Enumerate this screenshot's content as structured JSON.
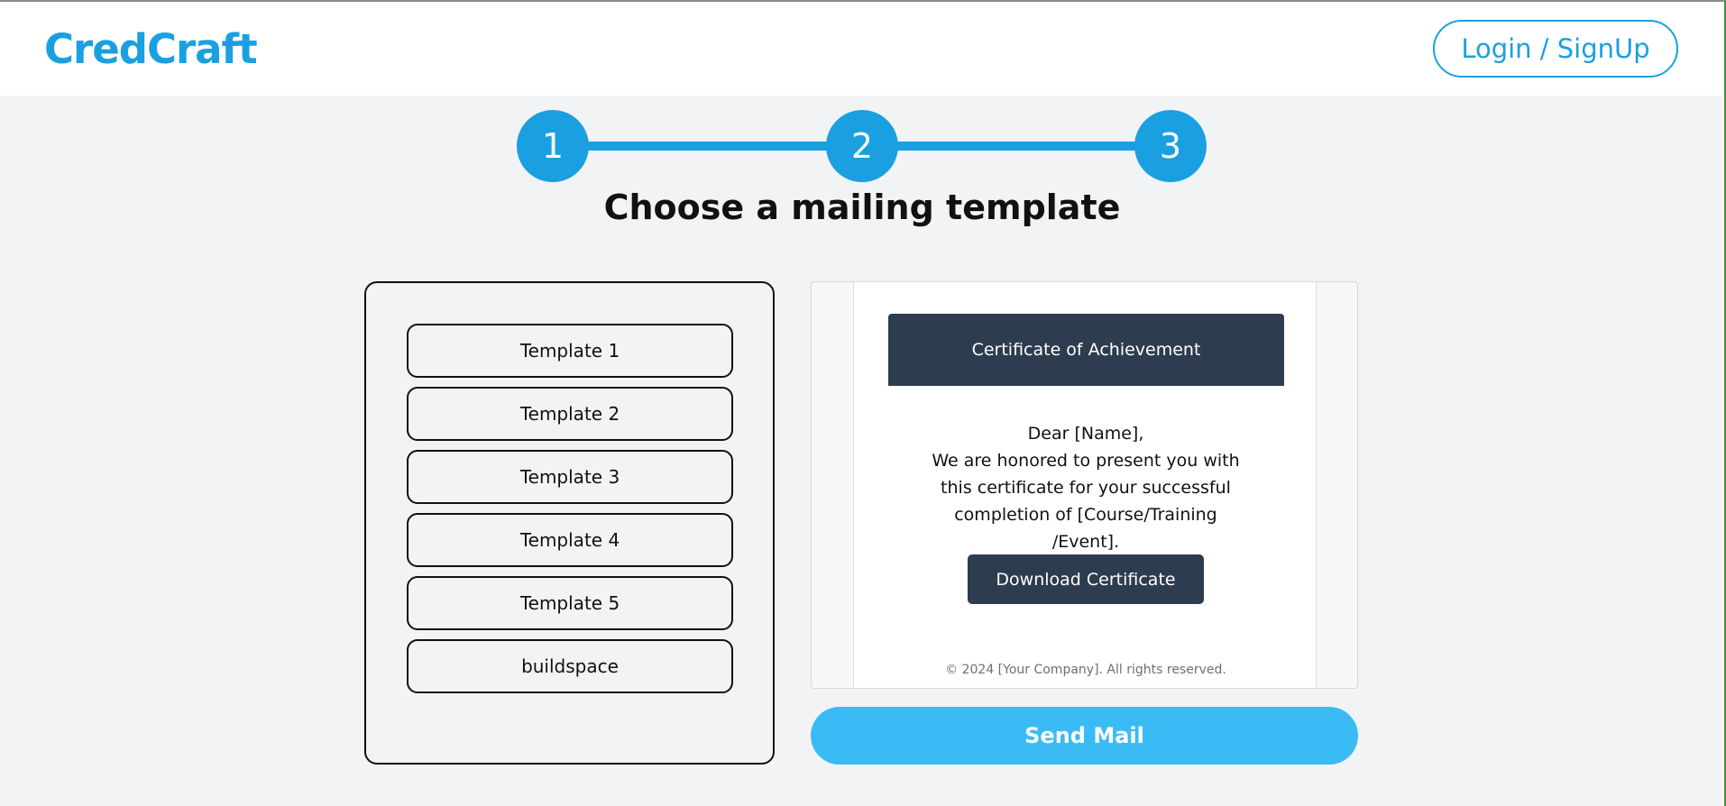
{
  "header": {
    "logo": "CredCraft",
    "login_label": "Login / SignUp"
  },
  "stepper": {
    "steps": [
      "1",
      "2",
      "3"
    ]
  },
  "main": {
    "title": "Choose a mailing template"
  },
  "templates": {
    "items": [
      "Template 1",
      "Template 2",
      "Template 3",
      "Template 4",
      "Template 5",
      "buildspace"
    ]
  },
  "preview": {
    "cert_title": "Certificate of Achievement",
    "greeting": "Dear [Name],",
    "message": "We are honored to present you with this certificate for your successful completion of [Course/Training /Event].",
    "download_label": "Download Certificate",
    "footer": "© 2024 [Your Company]. All rights reserved."
  },
  "actions": {
    "send_label": "Send Mail"
  },
  "colors": {
    "brand": "#1aa0e0",
    "send_button": "#3bbbf5",
    "certificate_dark": "#2d3c4e",
    "page_background": "#f1f3f5"
  }
}
